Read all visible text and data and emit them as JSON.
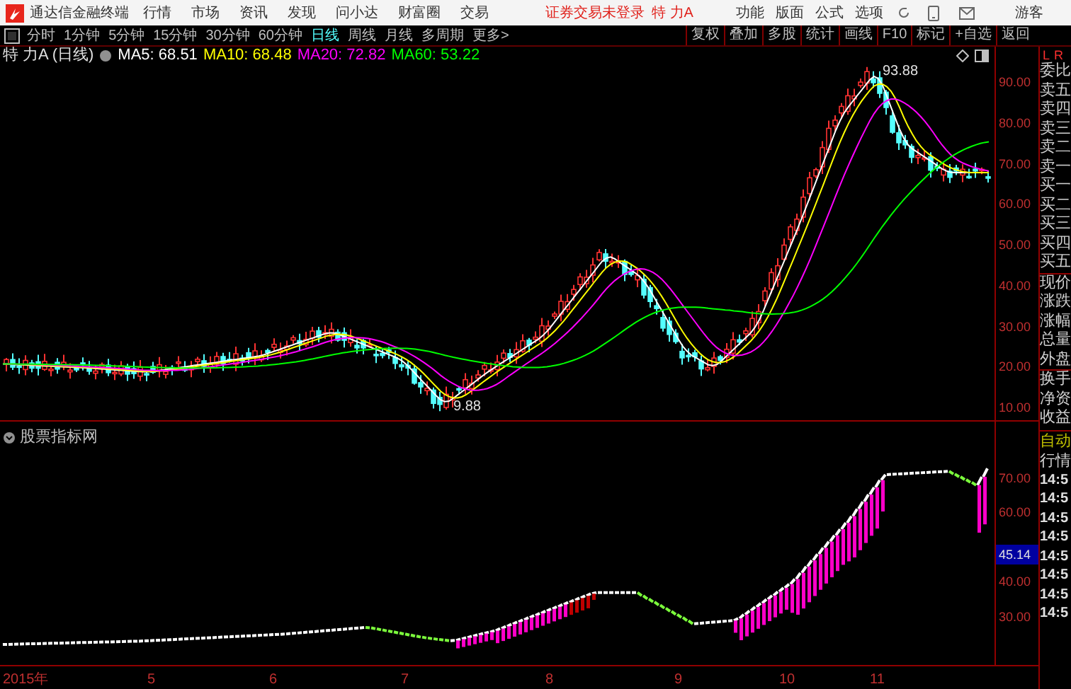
{
  "topbar": {
    "app_title": "通达信金融终端",
    "menus": [
      "行情",
      "市场",
      "资讯",
      "发现",
      "问小达",
      "财富圈",
      "交易"
    ],
    "login_status": "证券交易未登录",
    "stock_name": "特 力A",
    "actions": [
      "功能",
      "版面",
      "公式",
      "选项"
    ],
    "user": "游客"
  },
  "periods": [
    {
      "label": "分时",
      "selected": false
    },
    {
      "label": "1分钟",
      "selected": false
    },
    {
      "label": "5分钟",
      "selected": false
    },
    {
      "label": "15分钟",
      "selected": false
    },
    {
      "label": "30分钟",
      "selected": false
    },
    {
      "label": "60分钟",
      "selected": false
    },
    {
      "label": "日线",
      "selected": true
    },
    {
      "label": "周线",
      "selected": false
    },
    {
      "label": "月线",
      "selected": false
    },
    {
      "label": "多周期",
      "selected": false
    },
    {
      "label": "更多>",
      "selected": false
    }
  ],
  "tools": [
    "复权",
    "叠加",
    "多股",
    "统计",
    "画线",
    "F10",
    "标记",
    "+自选",
    "返回"
  ],
  "chart": {
    "title": "特 力A (日线)",
    "ma": [
      {
        "label": "MA5: 68.51",
        "color": "#ffffff"
      },
      {
        "label": "MA10: 68.48",
        "color": "#ffff00"
      },
      {
        "label": "MA20: 72.82",
        "color": "#ff00ff"
      },
      {
        "label": "MA60: 53.22",
        "color": "#00ff00"
      }
    ],
    "high_label": "93.88",
    "low_label": "9.88",
    "price_axis": [
      "90.00",
      "80.00",
      "70.00",
      "60.00",
      "50.00",
      "40.00",
      "30.00",
      "20.00",
      "10.00"
    ]
  },
  "indicator": {
    "title": "股票指标网",
    "axis": [
      "70.00",
      "60.00",
      "45.14",
      "40.00",
      "30.00"
    ]
  },
  "dates": [
    "2015年",
    "5",
    "6",
    "7",
    "8",
    "9",
    "10",
    "11"
  ],
  "side_panel": {
    "corner": [
      "L",
      "R"
    ],
    "fields": [
      "委比",
      "卖五",
      "卖四",
      "卖三",
      "卖二",
      "卖一",
      "买一",
      "买二",
      "买三",
      "买四",
      "买五",
      "现价",
      "涨跌",
      "涨幅",
      "总量",
      "外盘",
      "换手",
      "净资",
      "收益"
    ],
    "mode": [
      "自动",
      "行情"
    ],
    "times": [
      "14:5",
      "14:5",
      "14:5",
      "14:5",
      "14:5",
      "14:5",
      "14:5",
      "14:5"
    ]
  }
}
